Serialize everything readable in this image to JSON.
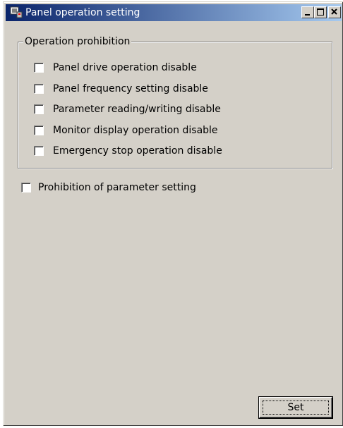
{
  "window": {
    "title": "Panel operation setting",
    "icon": "application-icon",
    "controls": {
      "minimize": "minimize-icon",
      "maximize": "maximize-icon",
      "close": "close-icon"
    }
  },
  "operation_prohibition": {
    "label": "Operation prohibition",
    "options": [
      {
        "label": "Panel drive operation disable",
        "checked": false
      },
      {
        "label": "Panel frequency setting disable",
        "checked": false
      },
      {
        "label": "Parameter reading/writing disable",
        "checked": false
      },
      {
        "label": "Monitor display operation disable",
        "checked": false
      },
      {
        "label": "Emergency stop operation disable",
        "checked": false
      }
    ]
  },
  "parameter_setting": {
    "label": "Prohibition of parameter setting",
    "checked": false
  },
  "buttons": {
    "set_label": "Set"
  },
  "colors": {
    "title_gradient_start": "#0a246a",
    "title_gradient_end": "#a6caf0",
    "face": "#d4d0c8"
  }
}
